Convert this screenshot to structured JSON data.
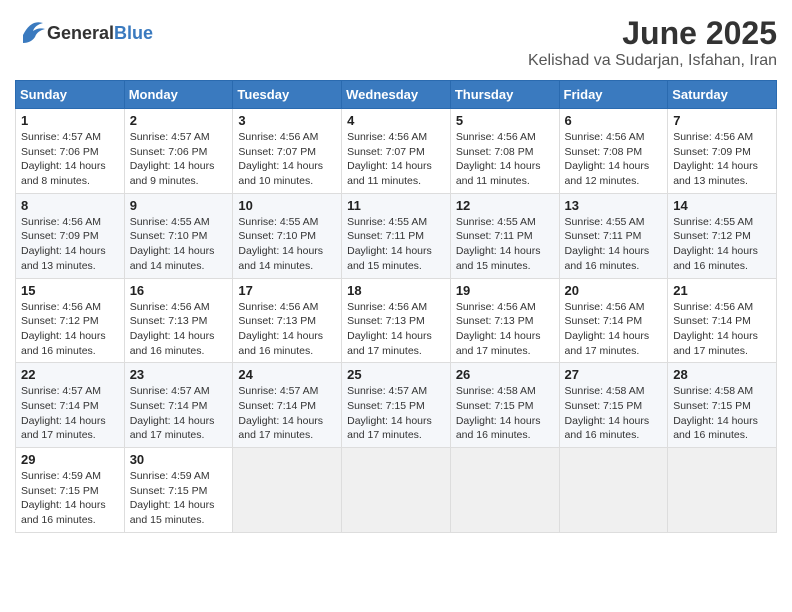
{
  "header": {
    "logo_general": "General",
    "logo_blue": "Blue",
    "month_title": "June 2025",
    "location": "Kelishad va Sudarjan, Isfahan, Iran"
  },
  "calendar": {
    "headers": [
      "Sunday",
      "Monday",
      "Tuesday",
      "Wednesday",
      "Thursday",
      "Friday",
      "Saturday"
    ],
    "weeks": [
      [
        {
          "day": "",
          "sunrise": "",
          "sunset": "",
          "daylight": "",
          "empty": true
        },
        {
          "day": "2",
          "sunrise": "Sunrise: 4:57 AM",
          "sunset": "Sunset: 7:06 PM",
          "daylight": "Daylight: 14 hours and 9 minutes."
        },
        {
          "day": "3",
          "sunrise": "Sunrise: 4:56 AM",
          "sunset": "Sunset: 7:07 PM",
          "daylight": "Daylight: 14 hours and 10 minutes."
        },
        {
          "day": "4",
          "sunrise": "Sunrise: 4:56 AM",
          "sunset": "Sunset: 7:07 PM",
          "daylight": "Daylight: 14 hours and 11 minutes."
        },
        {
          "day": "5",
          "sunrise": "Sunrise: 4:56 AM",
          "sunset": "Sunset: 7:08 PM",
          "daylight": "Daylight: 14 hours and 11 minutes."
        },
        {
          "day": "6",
          "sunrise": "Sunrise: 4:56 AM",
          "sunset": "Sunset: 7:08 PM",
          "daylight": "Daylight: 14 hours and 12 minutes."
        },
        {
          "day": "7",
          "sunrise": "Sunrise: 4:56 AM",
          "sunset": "Sunset: 7:09 PM",
          "daylight": "Daylight: 14 hours and 13 minutes."
        }
      ],
      [
        {
          "day": "1",
          "sunrise": "Sunrise: 4:57 AM",
          "sunset": "Sunset: 7:06 PM",
          "daylight": "Daylight: 14 hours and 8 minutes.",
          "first": true
        },
        {
          "day": "9",
          "sunrise": "Sunrise: 4:55 AM",
          "sunset": "Sunset: 7:10 PM",
          "daylight": "Daylight: 14 hours and 14 minutes."
        },
        {
          "day": "10",
          "sunrise": "Sunrise: 4:55 AM",
          "sunset": "Sunset: 7:10 PM",
          "daylight": "Daylight: 14 hours and 14 minutes."
        },
        {
          "day": "11",
          "sunrise": "Sunrise: 4:55 AM",
          "sunset": "Sunset: 7:11 PM",
          "daylight": "Daylight: 14 hours and 15 minutes."
        },
        {
          "day": "12",
          "sunrise": "Sunrise: 4:55 AM",
          "sunset": "Sunset: 7:11 PM",
          "daylight": "Daylight: 14 hours and 15 minutes."
        },
        {
          "day": "13",
          "sunrise": "Sunrise: 4:55 AM",
          "sunset": "Sunset: 7:11 PM",
          "daylight": "Daylight: 14 hours and 16 minutes."
        },
        {
          "day": "14",
          "sunrise": "Sunrise: 4:55 AM",
          "sunset": "Sunset: 7:12 PM",
          "daylight": "Daylight: 14 hours and 16 minutes."
        }
      ],
      [
        {
          "day": "8",
          "sunrise": "Sunrise: 4:56 AM",
          "sunset": "Sunset: 7:09 PM",
          "daylight": "Daylight: 14 hours and 13 minutes."
        },
        {
          "day": "16",
          "sunrise": "Sunrise: 4:56 AM",
          "sunset": "Sunset: 7:13 PM",
          "daylight": "Daylight: 14 hours and 16 minutes."
        },
        {
          "day": "17",
          "sunrise": "Sunrise: 4:56 AM",
          "sunset": "Sunset: 7:13 PM",
          "daylight": "Daylight: 14 hours and 16 minutes."
        },
        {
          "day": "18",
          "sunrise": "Sunrise: 4:56 AM",
          "sunset": "Sunset: 7:13 PM",
          "daylight": "Daylight: 14 hours and 17 minutes."
        },
        {
          "day": "19",
          "sunrise": "Sunrise: 4:56 AM",
          "sunset": "Sunset: 7:13 PM",
          "daylight": "Daylight: 14 hours and 17 minutes."
        },
        {
          "day": "20",
          "sunrise": "Sunrise: 4:56 AM",
          "sunset": "Sunset: 7:14 PM",
          "daylight": "Daylight: 14 hours and 17 minutes."
        },
        {
          "day": "21",
          "sunrise": "Sunrise: 4:56 AM",
          "sunset": "Sunset: 7:14 PM",
          "daylight": "Daylight: 14 hours and 17 minutes."
        }
      ],
      [
        {
          "day": "15",
          "sunrise": "Sunrise: 4:56 AM",
          "sunset": "Sunset: 7:12 PM",
          "daylight": "Daylight: 14 hours and 16 minutes."
        },
        {
          "day": "23",
          "sunrise": "Sunrise: 4:57 AM",
          "sunset": "Sunset: 7:14 PM",
          "daylight": "Daylight: 14 hours and 17 minutes."
        },
        {
          "day": "24",
          "sunrise": "Sunrise: 4:57 AM",
          "sunset": "Sunset: 7:14 PM",
          "daylight": "Daylight: 14 hours and 17 minutes."
        },
        {
          "day": "25",
          "sunrise": "Sunrise: 4:57 AM",
          "sunset": "Sunset: 7:15 PM",
          "daylight": "Daylight: 14 hours and 17 minutes."
        },
        {
          "day": "26",
          "sunrise": "Sunrise: 4:58 AM",
          "sunset": "Sunset: 7:15 PM",
          "daylight": "Daylight: 14 hours and 16 minutes."
        },
        {
          "day": "27",
          "sunrise": "Sunrise: 4:58 AM",
          "sunset": "Sunset: 7:15 PM",
          "daylight": "Daylight: 14 hours and 16 minutes."
        },
        {
          "day": "28",
          "sunrise": "Sunrise: 4:58 AM",
          "sunset": "Sunset: 7:15 PM",
          "daylight": "Daylight: 14 hours and 16 minutes."
        }
      ],
      [
        {
          "day": "22",
          "sunrise": "Sunrise: 4:57 AM",
          "sunset": "Sunset: 7:14 PM",
          "daylight": "Daylight: 14 hours and 17 minutes."
        },
        {
          "day": "30",
          "sunrise": "Sunrise: 4:59 AM",
          "sunset": "Sunset: 7:15 PM",
          "daylight": "Daylight: 14 hours and 15 minutes."
        },
        {
          "day": "",
          "empty": true
        },
        {
          "day": "",
          "empty": true
        },
        {
          "day": "",
          "empty": true
        },
        {
          "day": "",
          "empty": true
        },
        {
          "day": "",
          "empty": true
        }
      ],
      [
        {
          "day": "29",
          "sunrise": "Sunrise: 4:59 AM",
          "sunset": "Sunset: 7:15 PM",
          "daylight": "Daylight: 14 hours and 16 minutes."
        },
        {
          "day": "",
          "empty": true
        },
        {
          "day": "",
          "empty": true
        },
        {
          "day": "",
          "empty": true
        },
        {
          "day": "",
          "empty": true
        },
        {
          "day": "",
          "empty": true
        },
        {
          "day": "",
          "empty": true
        }
      ]
    ]
  }
}
